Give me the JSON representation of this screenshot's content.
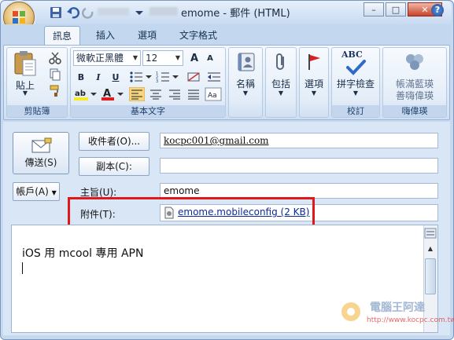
{
  "window": {
    "title": "emome - 郵件 (HTML)",
    "controls": {
      "minimize": "–",
      "maximize": "□",
      "close": "✕"
    }
  },
  "tabs": [
    "訊息",
    "插入",
    "選項",
    "文字格式"
  ],
  "active_tab": 0,
  "ribbon": {
    "clipboard": {
      "label": "剪貼簿",
      "paste": "貼上"
    },
    "text": {
      "label": "基本文字",
      "font_name": "微軟正黑體",
      "font_size": "12",
      "bold": "B",
      "italic": "I",
      "underline": "U",
      "grow": "A",
      "shrink": "A"
    },
    "names": {
      "label": "名稱"
    },
    "include": {
      "label": "包括"
    },
    "options": {
      "label": "選項"
    },
    "proofing": {
      "group_label": "校訂",
      "spell": "拼字檢查",
      "abc": "ABC"
    },
    "onenote": {
      "group_label": "嗨偉瑛",
      "line1": "帳滿藍瑛",
      "line2": "善嗨偉瑛"
    }
  },
  "compose": {
    "send": "傳送(S)",
    "account": "帳戶(A)",
    "to_button": "收件者(O)...",
    "to_value": "kocpc001@gmail.com",
    "cc_button": "副本(C):",
    "cc_value": "",
    "subject_label": "主旨(U):",
    "subject_value": "emome",
    "attach_label": "附件(T):",
    "attach_value": "emome.mobileconfig (2 KB)",
    "body": "iOS 用 mcool 專用 APN"
  },
  "watermark": {
    "line1": "電腦王阿達",
    "line2": "http://www.kocpc.com.tw"
  },
  "colors": {
    "accent": "#1d4d9b",
    "highlight": "#e0171b"
  }
}
